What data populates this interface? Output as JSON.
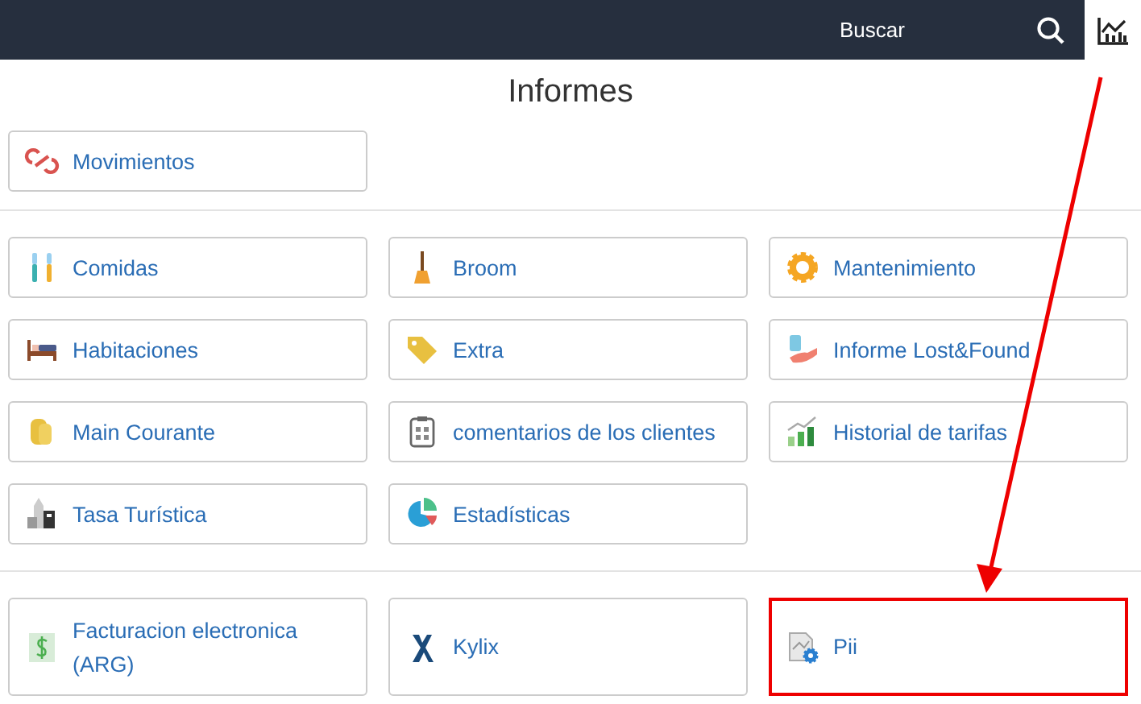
{
  "topbar": {
    "search": {
      "placeholder": "Buscar"
    }
  },
  "title": "Informes",
  "sections": [
    {
      "items": [
        {
          "label": "Movimientos",
          "highlighted": false
        }
      ]
    },
    {
      "items": [
        {
          "label": "Comidas",
          "highlighted": false
        },
        {
          "label": "Broom",
          "highlighted": false
        },
        {
          "label": "Mantenimiento",
          "highlighted": false
        },
        {
          "label": "Habitaciones",
          "highlighted": false
        },
        {
          "label": "Extra",
          "highlighted": false
        },
        {
          "label": "Informe Lost&Found",
          "highlighted": false
        },
        {
          "label": "Main Courante",
          "highlighted": false
        },
        {
          "label": "comentarios de los clientes",
          "highlighted": false
        },
        {
          "label": "Historial de tarifas",
          "highlighted": false
        },
        {
          "label": "Tasa Turística",
          "highlighted": false
        },
        {
          "label": "Estadísticas",
          "highlighted": false
        }
      ]
    },
    {
      "items": [
        {
          "label": "Facturacion electronica (ARG)",
          "highlighted": false
        },
        {
          "label": "Kylix",
          "highlighted": false
        },
        {
          "label": "Pii",
          "highlighted": true
        }
      ]
    }
  ]
}
